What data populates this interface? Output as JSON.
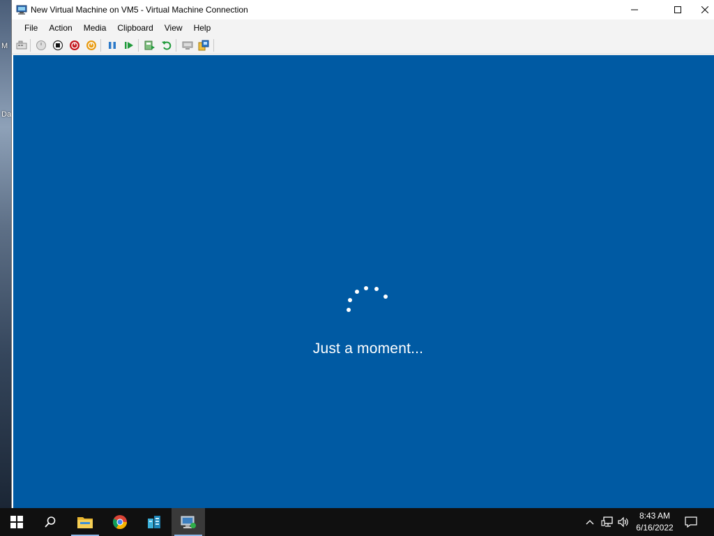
{
  "window": {
    "title": "New Virtual Machine on VM5 - Virtual Machine Connection"
  },
  "menu": {
    "items": [
      "File",
      "Action",
      "Media",
      "Clipboard",
      "View",
      "Help"
    ]
  },
  "toolbar": {
    "buttons": [
      "ctrl-alt-del",
      "start",
      "turn-off",
      "shut-down",
      "save",
      "pause",
      "reset",
      "checkpoint",
      "revert",
      "basic-session",
      "enhanced-session"
    ]
  },
  "vm_screen": {
    "background": "#005aa3",
    "status_text": "Just a moment..."
  },
  "desktop": {
    "labels": [
      "M",
      "Da"
    ]
  },
  "taskbar": {
    "apps": [
      "start-icon",
      "search-icon",
      "file-explorer-icon",
      "chrome-icon",
      "server-manager-icon",
      "vm-connection-icon"
    ],
    "clock_time": "8:43 AM",
    "clock_date": "6/16/2022"
  }
}
